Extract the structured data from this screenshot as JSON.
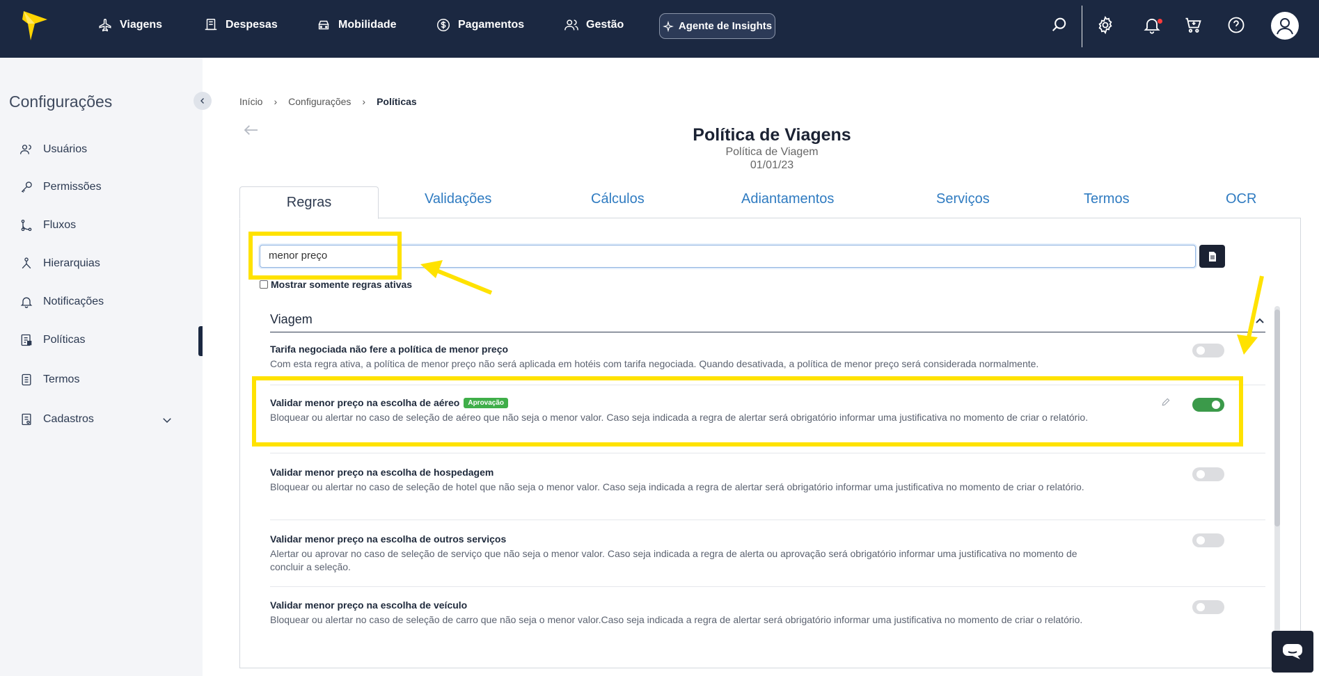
{
  "topbar": {
    "nav": [
      {
        "label": "Viagens",
        "icon": "plane-icon"
      },
      {
        "label": "Despesas",
        "icon": "receipt-icon"
      },
      {
        "label": "Mobilidade",
        "icon": "car-icon"
      },
      {
        "label": "Pagamentos",
        "icon": "dollar-icon"
      },
      {
        "label": "Gestão",
        "icon": "users-icon"
      }
    ],
    "insights_label": "Agente de Insights"
  },
  "sidebar": {
    "title": "Configurações",
    "items": [
      {
        "label": "Usuários",
        "icon": "users-icon"
      },
      {
        "label": "Permissões",
        "icon": "key-icon"
      },
      {
        "label": "Fluxos",
        "icon": "flow-icon"
      },
      {
        "label": "Hierarquias",
        "icon": "hierarchy-icon"
      },
      {
        "label": "Notificações",
        "icon": "bell-icon"
      },
      {
        "label": "Políticas",
        "icon": "policy-icon"
      },
      {
        "label": "Termos",
        "icon": "document-icon"
      },
      {
        "label": "Cadastros",
        "icon": "form-icon"
      }
    ],
    "active": "Políticas"
  },
  "breadcrumb": [
    "Início",
    "Configurações",
    "Políticas"
  ],
  "page": {
    "title": "Política de Viagens",
    "subtitle": "Política de Viagem",
    "date": "01/01/23"
  },
  "tabs": [
    "Regras",
    "Validações",
    "Cálculos",
    "Adiantamentos",
    "Serviços",
    "Termos",
    "OCR"
  ],
  "active_tab": "Regras",
  "search": {
    "value": "menor preço"
  },
  "only_active_label": "Mostrar somente regras ativas",
  "section": {
    "title": "Viagem"
  },
  "rules": [
    {
      "name": "Tarifa negociada não fere a política de menor preço",
      "desc": "Com esta regra ativa, a política de menor preço não será aplicada em hotéis com tarifa negociada. Quando desativada, a política de menor preço será considerada normalmente.",
      "enabled": false
    },
    {
      "name": "Validar menor preço na escolha de aéreo",
      "badge": "Aprovação",
      "desc": "Bloquear ou alertar no caso de seleção de aéreo que não seja o menor valor. Caso seja indicada a regra de alertar será obrigatório informar uma justificativa no momento de criar o relatório.",
      "enabled": true
    },
    {
      "name": "Validar menor preço na escolha de hospedagem",
      "desc": "Bloquear ou alertar no caso de seleção de hotel que não seja o menor valor. Caso seja indicada a regra de alertar será obrigatório informar uma justificativa no momento de criar o relatório.",
      "enabled": false
    },
    {
      "name": "Validar menor preço na escolha de outros serviços",
      "desc": "Alertar ou aprovar no caso de seleção de serviço que não seja o menor valor. Caso seja indicada a regra de alerta ou aprovação será obrigatório informar uma justificativa no momento de concluir a seleção.",
      "enabled": false
    },
    {
      "name": "Validar menor preço na escolha de veículo",
      "desc": "Bloquear ou alertar no caso de seleção de carro que não seja o menor valor.Caso seja indicada a regra de alertar será obrigatório informar uma justificativa no momento de criar o relatório.",
      "enabled": false
    }
  ],
  "colors": {
    "nav_bg": "#1b2841",
    "highlight": "#ffe200",
    "toggle_on": "#3b9a4a",
    "tab_link": "#2f7bc1",
    "badge": "#3fae49"
  }
}
